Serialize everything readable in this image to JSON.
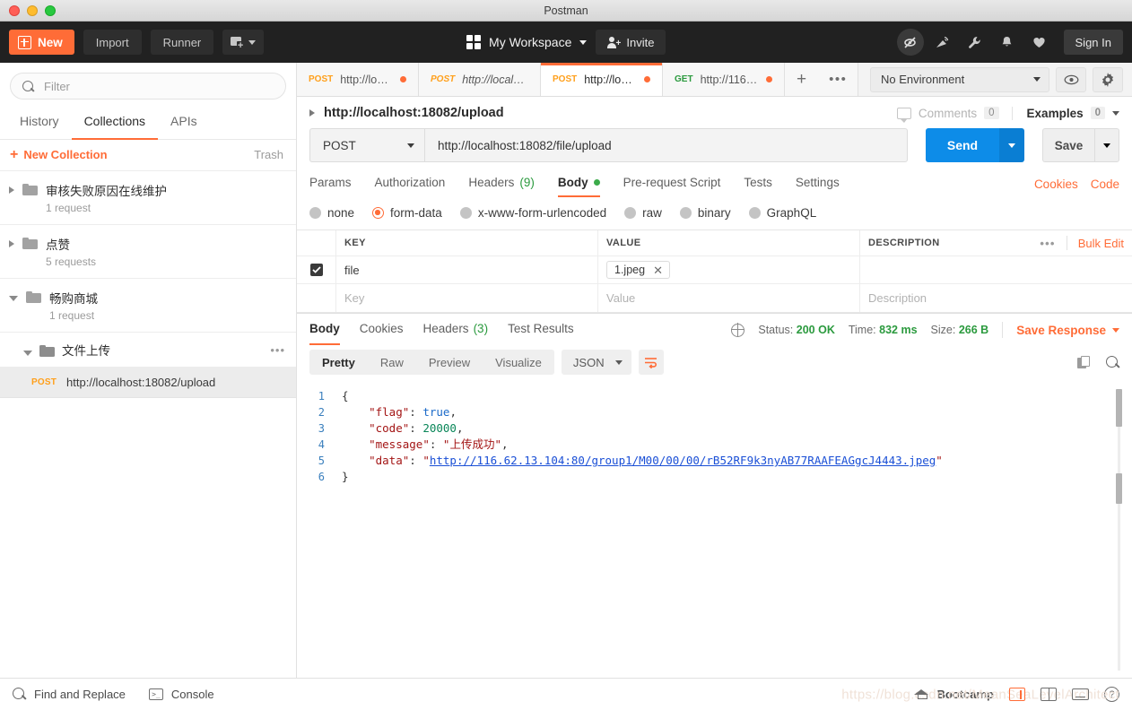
{
  "window": {
    "title": "Postman"
  },
  "topbar": {
    "new_label": "New",
    "import_label": "Import",
    "runner_label": "Runner",
    "workspace_label": "My Workspace",
    "invite_label": "Invite",
    "signin_label": "Sign In",
    "icons": [
      "sync-off-icon",
      "broadcast-icon",
      "wrench-icon",
      "bell-icon",
      "heart-icon"
    ]
  },
  "sidebar": {
    "filter_placeholder": "Filter",
    "tabs": [
      {
        "label": "History",
        "active": false
      },
      {
        "label": "Collections",
        "active": true
      },
      {
        "label": "APIs",
        "active": false
      }
    ],
    "new_collection_label": "New Collection",
    "trash_label": "Trash",
    "collections": [
      {
        "name": "审核失败原因在线维护",
        "sub": "1 request",
        "expanded": false
      },
      {
        "name": "点赞",
        "sub": "5 requests",
        "expanded": false
      },
      {
        "name": "畅购商城",
        "sub": "1 request",
        "expanded": true
      }
    ],
    "folder": {
      "name": "文件上传",
      "expanded": true
    },
    "request": {
      "method": "POST",
      "url": "http://localhost:18082/upload"
    }
  },
  "tabs": [
    {
      "method": "POST",
      "url": "http://localh...",
      "active": false,
      "unsaved": true,
      "italic": false
    },
    {
      "method": "POST",
      "url": "http://localh...",
      "active": false,
      "unsaved": false,
      "italic": true
    },
    {
      "method": "POST",
      "url": "http://localh...",
      "active": true,
      "unsaved": true,
      "italic": false
    },
    {
      "method": "GET",
      "url": "http://116.62....",
      "active": false,
      "unsaved": true,
      "italic": false
    }
  ],
  "environment": {
    "selected": "No Environment"
  },
  "request": {
    "title": "http://localhost:18082/upload",
    "comments_label": "Comments",
    "comments_count": "0",
    "examples_label": "Examples",
    "examples_count": "0",
    "method": "POST",
    "url": "http://localhost:18082/file/upload",
    "send_label": "Send",
    "save_label": "Save",
    "tabs": [
      {
        "label": "Params",
        "active": false,
        "count": ""
      },
      {
        "label": "Authorization",
        "active": false,
        "count": ""
      },
      {
        "label": "Headers",
        "active": false,
        "count": "(9)"
      },
      {
        "label": "Body",
        "active": true,
        "count": ""
      },
      {
        "label": "Pre-request Script",
        "active": false,
        "count": ""
      },
      {
        "label": "Tests",
        "active": false,
        "count": ""
      },
      {
        "label": "Settings",
        "active": false,
        "count": ""
      }
    ],
    "links": [
      "Cookies",
      "Code"
    ],
    "body_types": [
      {
        "label": "none",
        "selected": false
      },
      {
        "label": "form-data",
        "selected": true
      },
      {
        "label": "x-www-form-urlencoded",
        "selected": false
      },
      {
        "label": "raw",
        "selected": false
      },
      {
        "label": "binary",
        "selected": false
      },
      {
        "label": "GraphQL",
        "selected": false
      }
    ],
    "table": {
      "headers": {
        "key": "KEY",
        "value": "VALUE",
        "description": "DESCRIPTION"
      },
      "bulk_edit_label": "Bulk Edit",
      "rows": [
        {
          "checked": true,
          "key": "file",
          "value": "1.jpeg",
          "description": "",
          "is_file": true
        }
      ],
      "placeholders": {
        "key": "Key",
        "value": "Value",
        "description": "Description"
      }
    }
  },
  "response": {
    "tabs": [
      {
        "label": "Body",
        "active": true,
        "count": ""
      },
      {
        "label": "Cookies",
        "active": false,
        "count": ""
      },
      {
        "label": "Headers",
        "active": false,
        "count": "(3)"
      },
      {
        "label": "Test Results",
        "active": false,
        "count": ""
      }
    ],
    "status_label": "Status:",
    "status_value": "200 OK",
    "time_label": "Time:",
    "time_value": "832 ms",
    "size_label": "Size:",
    "size_value": "266 B",
    "save_response_label": "Save Response",
    "view_modes": [
      {
        "label": "Pretty",
        "active": true
      },
      {
        "label": "Raw",
        "active": false
      },
      {
        "label": "Preview",
        "active": false
      },
      {
        "label": "Visualize",
        "active": false
      }
    ],
    "format": "JSON",
    "line_numbers": [
      "1",
      "2",
      "3",
      "4",
      "5",
      "6"
    ],
    "json": {
      "flag": "true",
      "code": "20000",
      "message": "上传成功",
      "data": "http://116.62.13.104:80/group1/M00/00/00/rB52RF9k3nyAB77RAAFEAGgcJ4443.jpeg"
    }
  },
  "footer": {
    "find_replace_label": "Find and Replace",
    "console_label": "Console",
    "bootcamp_label": "Bootcamp",
    "watermark": "https://blog.csdn.net/MeanSeaLevelArchitect"
  },
  "colors": {
    "accent": "#ff6c37",
    "send_blue": "#0d8ce8",
    "success_green": "#2b9a3e",
    "dark_bar": "#212121"
  }
}
